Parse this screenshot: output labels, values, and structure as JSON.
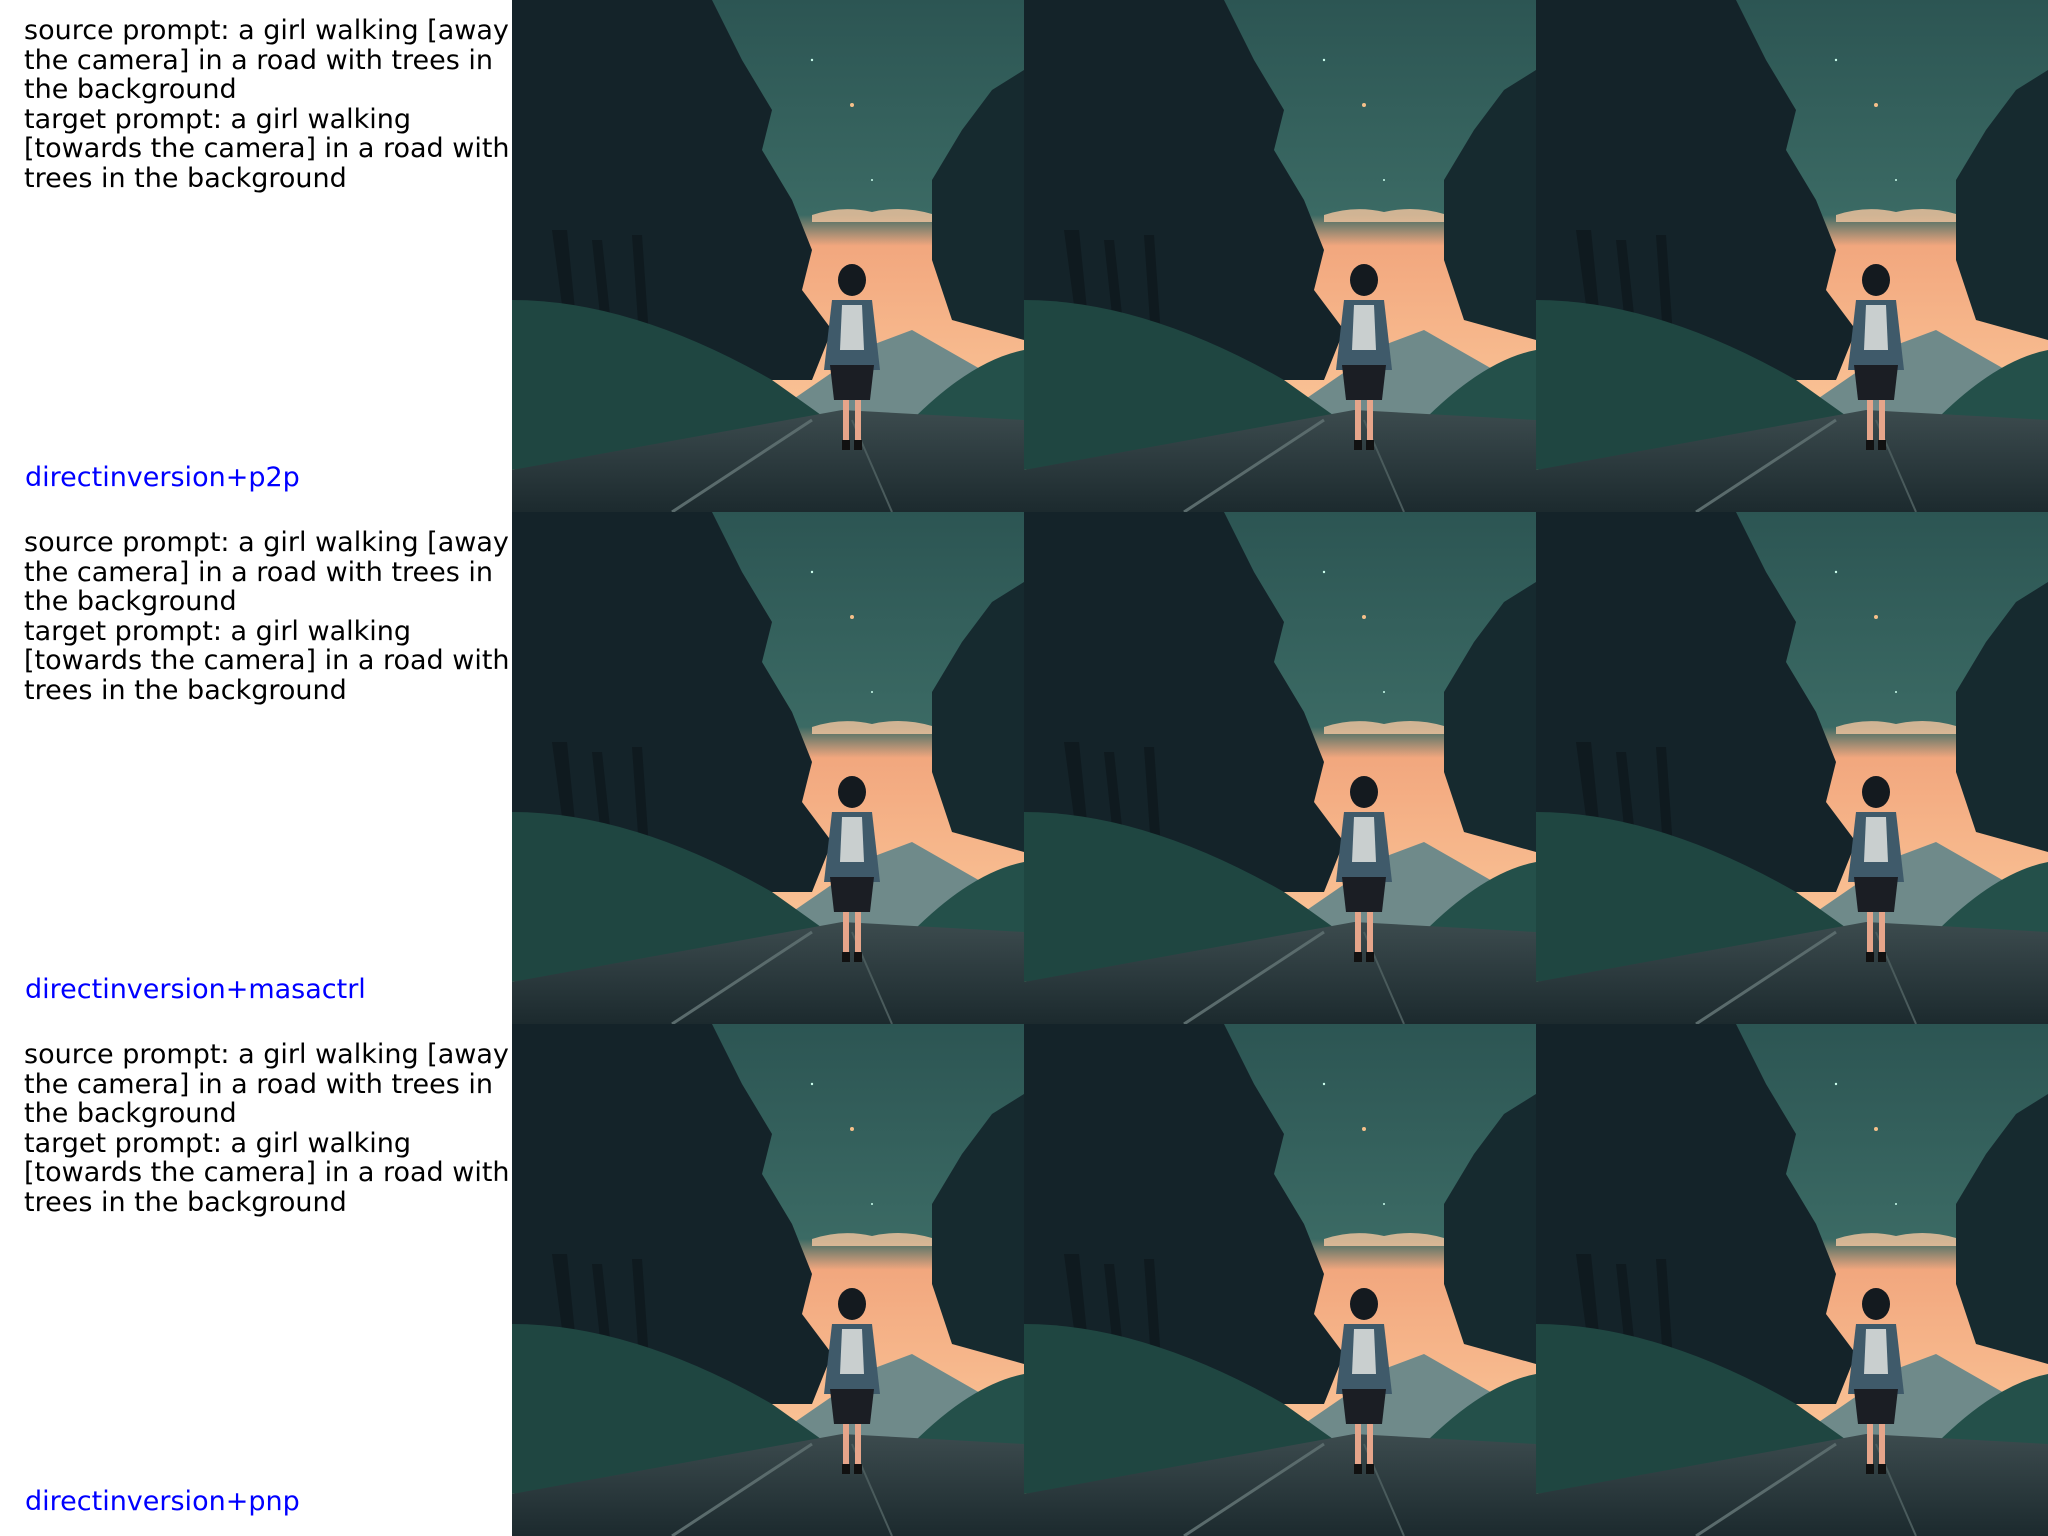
{
  "rows": [
    {
      "source_prompt": "source prompt: a girl walking [away the camera] in a road with trees in the background",
      "target_prompt": "target prompt: a girl walking [towards the camera] in a road with trees in the background",
      "method": "directinversion+p2p"
    },
    {
      "source_prompt": "source prompt: a girl walking [away the camera] in a road with trees in the background",
      "target_prompt": "target prompt: a girl walking [towards the camera] in a road with trees in the background",
      "method": "directinversion+masactrl"
    },
    {
      "source_prompt": "source prompt: a girl walking [away the camera] in a road with trees in the background",
      "target_prompt": "target prompt: a girl walking [towards the camera] in a road with trees in the background",
      "method": "directinversion+pnp"
    }
  ],
  "colors": {
    "sky_dark": "#2f5a58",
    "sky_glow": "#f7b184",
    "tree_dark": "#14232a",
    "foliage": "#1f4a45",
    "road": "#2b3a3e",
    "method_text": "#0000ff"
  }
}
